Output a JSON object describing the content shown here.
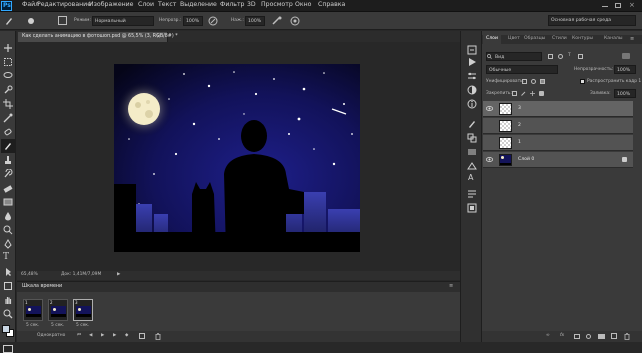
{
  "app": {
    "logo": "Ps"
  },
  "menu": [
    "Файл",
    "Редактирование",
    "Изображение",
    "Слои",
    "Текст",
    "Выделение",
    "Фильтр",
    "3D",
    "Просмотр",
    "Окно",
    "Справка"
  ],
  "options": {
    "mode_label": "Режим:",
    "mode_value": "Нормальный",
    "opacity_label": "Непрозр.:",
    "opacity_value": "100%",
    "pressure_label": "Наж.:",
    "pressure_value": "100%",
    "workspace": "Основная рабочая среда"
  },
  "document": {
    "tab_title": "Как сделать анимацию в фотошоп.psd @ 65,5% (3, RGB/8#) *",
    "zoom": "65,48%",
    "doc_info": "Док: 1,41М/7,09М"
  },
  "timeline": {
    "title": "Шкала времени",
    "frames": [
      {
        "num": "1",
        "delay": "5 сек."
      },
      {
        "num": "2",
        "delay": "5 сек."
      },
      {
        "num": "3",
        "delay": "5 сек."
      }
    ],
    "loop": "Однократно"
  },
  "panel_tabs": [
    "Слои",
    "Цвет",
    "Образцы",
    "Стили",
    "Контуры",
    "Каналы"
  ],
  "layers_panel": {
    "filter_kind": "Вид",
    "blend_mode": "Обычные",
    "opacity_label": "Непрозрачность:",
    "opacity_value": "100%",
    "unify_label": "Унифицировать:",
    "propagate_label": "Распространить кадр 1",
    "lock_label": "Закрепить:",
    "fill_label": "Заливка:",
    "fill_value": "100%"
  },
  "layers": [
    {
      "name": "3",
      "selected": true
    },
    {
      "name": "2",
      "selected": false
    },
    {
      "name": "1",
      "selected": false
    },
    {
      "name": "Слой 0",
      "selected": false
    }
  ],
  "colors": {
    "accent": "#31a8ff",
    "sky": "#0d0d40",
    "moon": "#f4ecc8"
  }
}
